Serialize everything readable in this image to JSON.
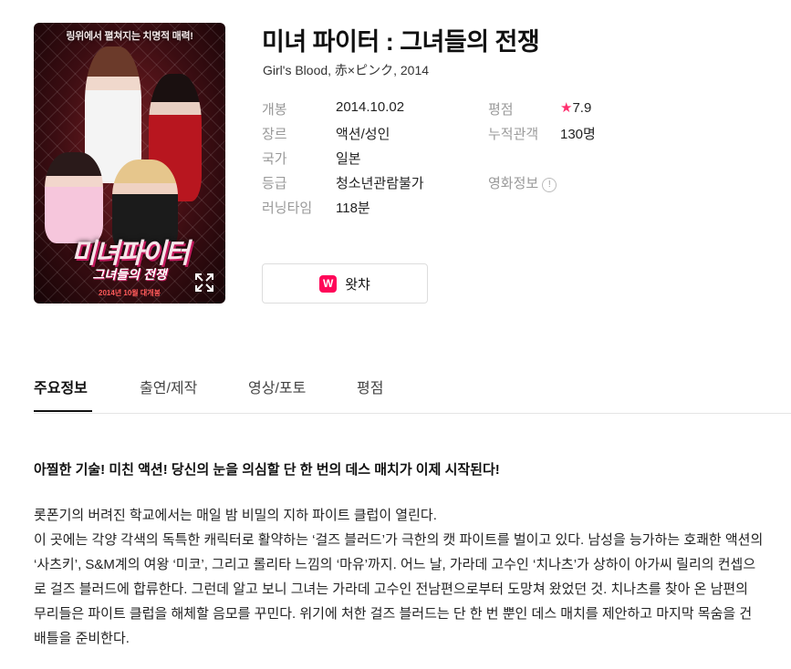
{
  "movie": {
    "title": "미녀 파이터 : 그녀들의 전쟁",
    "subtitle": "Girl's Blood, 赤×ピンク, 2014"
  },
  "poster": {
    "tagline": "링위에서 펼쳐지는 치명적 매력!",
    "title_text": "미녀파이터",
    "subtitle_text": "그녀들의 전쟁",
    "release_text": "2014년 10월 대개봉",
    "expand_icon": "expand-icon"
  },
  "info": {
    "release_label": "개봉",
    "release_value": "2014.10.02",
    "genre_label": "장르",
    "genre_value": "액션/성인",
    "country_label": "국가",
    "country_value": "일본",
    "rating_label": "등급",
    "rating_value": "청소년관람불가",
    "runtime_label": "러닝타임",
    "runtime_value": "118분",
    "score_label": "평점",
    "score_star": "★",
    "score_value": "7.9",
    "audience_label": "누적관객",
    "audience_value": "130명",
    "movieinfo_label": "영화정보",
    "movieinfo_help": "!"
  },
  "watcha": {
    "icon_letter": "W",
    "label": "왓챠",
    "brand_color": "#ff0558"
  },
  "tabs": [
    "주요정보",
    "출연/제작",
    "영상/포토",
    "평점"
  ],
  "headline": "아찔한 기술! 미친 액션! 당신의 눈을 의심할 단 한 번의 데스 매치가 이제 시작된다!",
  "synopsis": [
    "롯폰기의 버려진 학교에서는 매일 밤 비밀의 지하 파이트 클럽이 열린다.",
    "이 곳에는 각양 각색의 독특한 캐릭터로 활약하는 ‘걸즈 블러드’가 극한의 캣 파이트를 벌이고 있다. 남성을 능가하는 호쾌한 액션의 ‘사츠키’, S&M계의 여왕 ‘미코’, 그리고 롤리타 느낌의 ‘마유’까지. 어느 날, 가라데 고수인 ‘치나츠’가 상하이 아가씨 릴리의 컨셉으로 걸즈 블러드에 합류한다. 그런데 알고 보니 그녀는 가라데 고수인 전남편으로부터 도망쳐 왔었던 것. 치나츠를 찾아 온 남편의 무리들은 파이트 클럽을 해체할 음모를 꾸민다. 위기에 처한 걸즈 블러드는 단 한 번 뿐인 데스 매치를 제안하고 마지막 목숨을 건 배틀을 준비한다."
  ]
}
